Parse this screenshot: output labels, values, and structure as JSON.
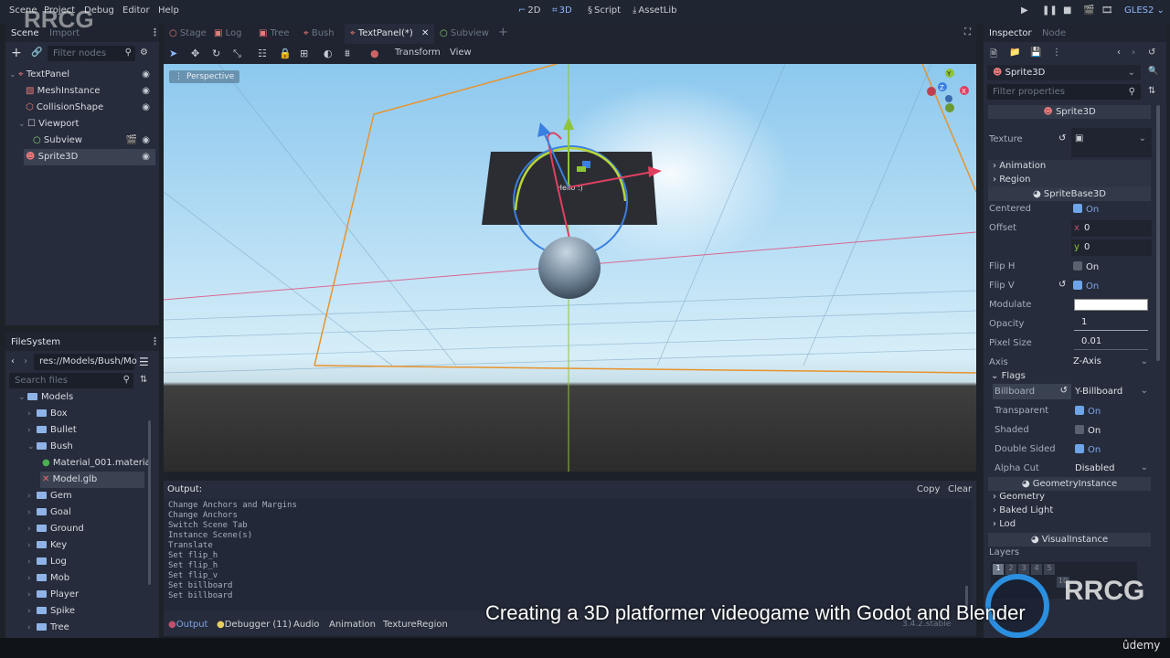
{
  "menu": [
    "Scene",
    "Project",
    "Debug",
    "Editor",
    "Help"
  ],
  "workspaces": [
    {
      "icon": "2d-icon",
      "label": "2D"
    },
    {
      "icon": "3d-icon",
      "label": "3D"
    },
    {
      "icon": "script-icon",
      "label": "Script"
    },
    {
      "icon": "assetlib-icon",
      "label": "AssetLib"
    }
  ],
  "renderer": "GLES2",
  "scene_dock": {
    "tabs": [
      "Scene",
      "Import"
    ],
    "filter_placeholder": "Filter nodes",
    "nodes": [
      {
        "name": "TextPanel",
        "icon": "control-icon",
        "color": "#ec7a7a",
        "depth": 0,
        "expanded": true
      },
      {
        "name": "MeshInstance",
        "icon": "mesh-icon",
        "color": "#ec7a7a",
        "depth": 1
      },
      {
        "name": "CollisionShape",
        "icon": "collision-icon",
        "color": "#ec7a7a",
        "depth": 1
      },
      {
        "name": "Viewport",
        "icon": "viewport-icon",
        "color": "#d8dce2",
        "depth": 1,
        "expanded": true
      },
      {
        "name": "Subview",
        "icon": "node-icon",
        "color": "#8ed56f",
        "depth": 2
      },
      {
        "name": "Sprite3D",
        "icon": "sprite-icon",
        "color": "#ec7a7a",
        "depth": 1,
        "selected": true
      }
    ]
  },
  "filesystem": {
    "title": "FileSystem",
    "path": "res://Models/Bush/Mo",
    "search_placeholder": "Search files",
    "items": [
      {
        "name": "Models",
        "type": "folder",
        "depth": 0,
        "expanded": true
      },
      {
        "name": "Box",
        "type": "folder",
        "depth": 1
      },
      {
        "name": "Bullet",
        "type": "folder",
        "depth": 1
      },
      {
        "name": "Bush",
        "type": "folder",
        "depth": 1,
        "expanded": true
      },
      {
        "name": "Material_001.materia",
        "type": "material",
        "depth": 2
      },
      {
        "name": "Model.glb",
        "type": "scene",
        "depth": 2,
        "selected": true
      },
      {
        "name": "Gem",
        "type": "folder",
        "depth": 1
      },
      {
        "name": "Goal",
        "type": "folder",
        "depth": 1
      },
      {
        "name": "Ground",
        "type": "folder",
        "depth": 1
      },
      {
        "name": "Key",
        "type": "folder",
        "depth": 1
      },
      {
        "name": "Log",
        "type": "folder",
        "depth": 1
      },
      {
        "name": "Mob",
        "type": "folder",
        "depth": 1
      },
      {
        "name": "Player",
        "type": "folder",
        "depth": 1
      },
      {
        "name": "Spike",
        "type": "folder",
        "depth": 1
      },
      {
        "name": "Tree",
        "type": "folder",
        "depth": 1
      }
    ]
  },
  "scene_tabs": [
    {
      "label": "Stage",
      "active": false
    },
    {
      "label": "Log",
      "active": false
    },
    {
      "label": "Tree",
      "active": false
    },
    {
      "label": "Bush",
      "active": false
    },
    {
      "label": "TextPanel(*)",
      "active": true
    },
    {
      "label": "Subview",
      "active": false
    }
  ],
  "viewport": {
    "toolbar": {
      "transform": "Transform",
      "view": "View"
    },
    "mode_label": "Perspective",
    "panel_text": "Hello :)",
    "gizmo_axes": [
      "Y",
      "Z",
      "X"
    ]
  },
  "output": {
    "title": "Output:",
    "copy_label": "Copy",
    "clear_label": "Clear",
    "lines": [
      "Change Anchors and Margins",
      "Change Anchors",
      "Switch Scene Tab",
      "Instance Scene(s)",
      "Translate",
      "Set flip_h",
      "Set flip_h",
      "Set flip_v",
      "Set billboard",
      "Set billboard"
    ],
    "bottom_tabs": [
      "Output",
      "Debugger (11)",
      "Audio",
      "Animation",
      "TextureRegion"
    ],
    "version": "3.4.2.stable"
  },
  "inspector": {
    "tabs": [
      "Inspector",
      "Node"
    ],
    "object": "Sprite3D",
    "filter_placeholder": "Filter properties",
    "class_header": "Sprite3D",
    "texture_label": "Texture",
    "groups1": [
      "Animation",
      "Region"
    ],
    "spritebase_header": "SpriteBase3D",
    "props": {
      "centered": {
        "label": "Centered",
        "value": "On",
        "checked": true
      },
      "offset": {
        "label": "Offset",
        "x": "0",
        "y": "0"
      },
      "flip_h": {
        "label": "Flip H",
        "value": "On",
        "checked": false
      },
      "flip_v": {
        "label": "Flip V",
        "value": "On",
        "checked": true
      },
      "modulate": {
        "label": "Modulate",
        "color": "#ffffff"
      },
      "opacity": {
        "label": "Opacity",
        "value": "1"
      },
      "pixel_size": {
        "label": "Pixel Size",
        "value": "0.01"
      },
      "axis": {
        "label": "Axis",
        "value": "Z-Axis"
      }
    },
    "flags": {
      "title": "Flags",
      "billboard": {
        "label": "Billboard",
        "value": "Y-Billboard"
      },
      "transparent": {
        "label": "Transparent",
        "value": "On",
        "checked": true
      },
      "shaded": {
        "label": "Shaded",
        "value": "On",
        "checked": false
      },
      "double_sided": {
        "label": "Double Sided",
        "value": "On",
        "checked": true
      },
      "alpha_cut": {
        "label": "Alpha Cut",
        "value": "Disabled"
      }
    },
    "geometry_header": "GeometryInstance",
    "groups2": [
      "Geometry",
      "Baked Light",
      "Lod"
    ],
    "visual_header": "VisualInstance",
    "layers_label": "Layers",
    "layers": [
      "1",
      "2",
      "3",
      "4",
      "5",
      "10"
    ]
  },
  "overlay": {
    "subtitle": "Creating a 3D platformer videogame with Godot and Blender",
    "watermark": "RRCG",
    "brand": "ûdemy"
  }
}
